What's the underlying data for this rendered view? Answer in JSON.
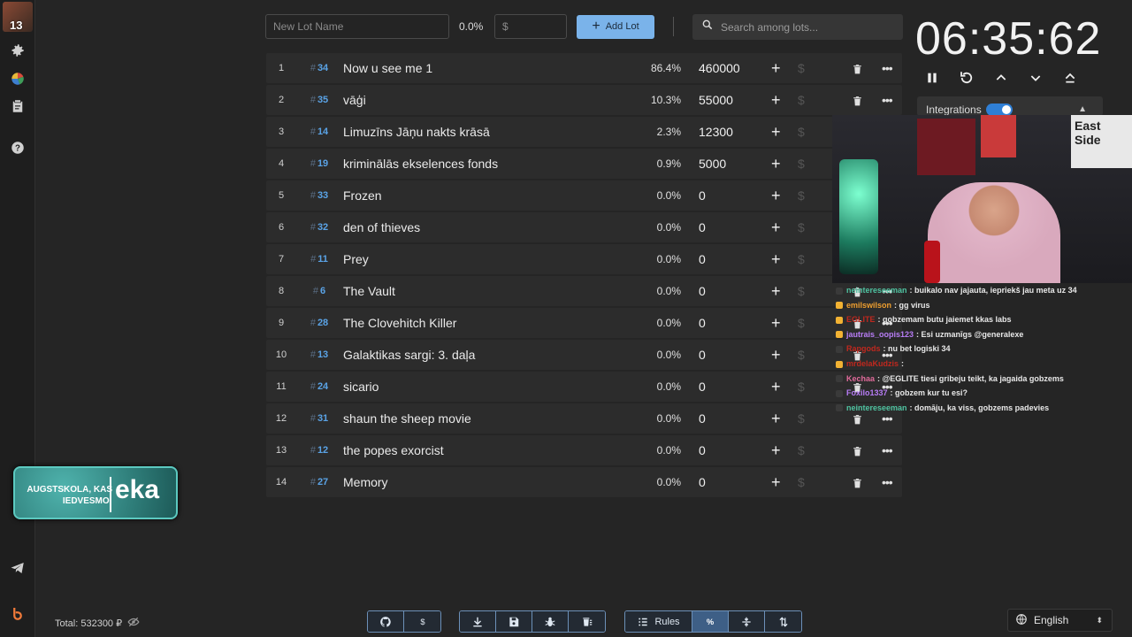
{
  "sidebar": {
    "avatar_count": "13"
  },
  "toolbar": {
    "new_lot_placeholder": "New Lot Name",
    "percent": "0.0%",
    "money_placeholder": "$",
    "add_lot_label": "Add Lot",
    "search_placeholder": "Search among lots..."
  },
  "lots": [
    {
      "idx": "1",
      "id": "34",
      "name": "Now u see me 1",
      "pct": "86.4%",
      "amount": "460000"
    },
    {
      "idx": "2",
      "id": "35",
      "name": "vāģi",
      "pct": "10.3%",
      "amount": "55000"
    },
    {
      "idx": "3",
      "id": "14",
      "name": "Limuzīns Jāņu nakts krāsā",
      "pct": "2.3%",
      "amount": "12300"
    },
    {
      "idx": "4",
      "id": "19",
      "name": "kriminālās ekselences fonds",
      "pct": "0.9%",
      "amount": "5000"
    },
    {
      "idx": "5",
      "id": "33",
      "name": "Frozen",
      "pct": "0.0%",
      "amount": "0"
    },
    {
      "idx": "6",
      "id": "32",
      "name": "den of thieves",
      "pct": "0.0%",
      "amount": "0"
    },
    {
      "idx": "7",
      "id": "11",
      "name": "Prey",
      "pct": "0.0%",
      "amount": "0"
    },
    {
      "idx": "8",
      "id": "6",
      "name": "The Vault",
      "pct": "0.0%",
      "amount": "0"
    },
    {
      "idx": "9",
      "id": "28",
      "name": "The Clovehitch Killer",
      "pct": "0.0%",
      "amount": "0"
    },
    {
      "idx": "10",
      "id": "13",
      "name": "Galaktikas sargi: 3. daļa",
      "pct": "0.0%",
      "amount": "0"
    },
    {
      "idx": "11",
      "id": "24",
      "name": "sicario",
      "pct": "0.0%",
      "amount": "0"
    },
    {
      "idx": "12",
      "id": "31",
      "name": "shaun the sheep movie",
      "pct": "0.0%",
      "amount": "0"
    },
    {
      "idx": "13",
      "id": "12",
      "name": "the popes exorcist",
      "pct": "0.0%",
      "amount": "0"
    },
    {
      "idx": "14",
      "id": "27",
      "name": "Memory",
      "pct": "0.0%",
      "amount": "0"
    }
  ],
  "timer": {
    "value": "06:35:62"
  },
  "integrations": {
    "label": "Integrations"
  },
  "promo": {
    "left_text": "AUGSTSKOLA, KAS IEDVESMO!",
    "right_text": "eka"
  },
  "webcam": {
    "sign_text": "East Side"
  },
  "chat": [
    {
      "user": "neintereseeman",
      "text": ": buikalo nav jajauta, iepriekš jau meta uz 34",
      "color": "#4fc3a1",
      "badge": "#3a3a3a"
    },
    {
      "user": "emilswilson",
      "text": ": gg virus",
      "color": "#f0a030",
      "badge": "#f2b233"
    },
    {
      "user": "EGLITE",
      "text": ": gobzemam butu jaiemet kkas labs",
      "color": "#c0281e",
      "badge": "#f2b233"
    },
    {
      "user": "jautrais_oopis123",
      "text": ": Esi uzmanīgs @generalexe",
      "color": "#b77cf5",
      "badge": "#f2b233"
    },
    {
      "user": "Rapgods",
      "text": ": nu bet logiski 34",
      "color": "#c0281e",
      "badge": "#3a3a3a"
    },
    {
      "user": "mrdelaKudzis",
      "text": ":",
      "color": "#c0281e",
      "badge": "#f2b233"
    },
    {
      "user": "Kechaa",
      "text": ": @EGLITE tiesi gribeju teikt, ka jagaida gobzems",
      "color": "#e06a9a",
      "badge": "#3a3a3a"
    },
    {
      "user": "Foxilo1337",
      "text": ": gobzem kur tu esi?",
      "color": "#b77cf5",
      "badge": "#3a3a3a"
    },
    {
      "user": "neintereseeman",
      "text": ": domāju, ka viss, gobzems padevies",
      "color": "#4fc3a1",
      "badge": "#3a3a3a"
    }
  ],
  "footer": {
    "total": "Total: 532300 ₽",
    "rules_label": "Rules",
    "language": "English"
  },
  "colors": {
    "accent": "#7ab3ea",
    "id_blue": "#5aa3e6",
    "background": "#252525"
  }
}
